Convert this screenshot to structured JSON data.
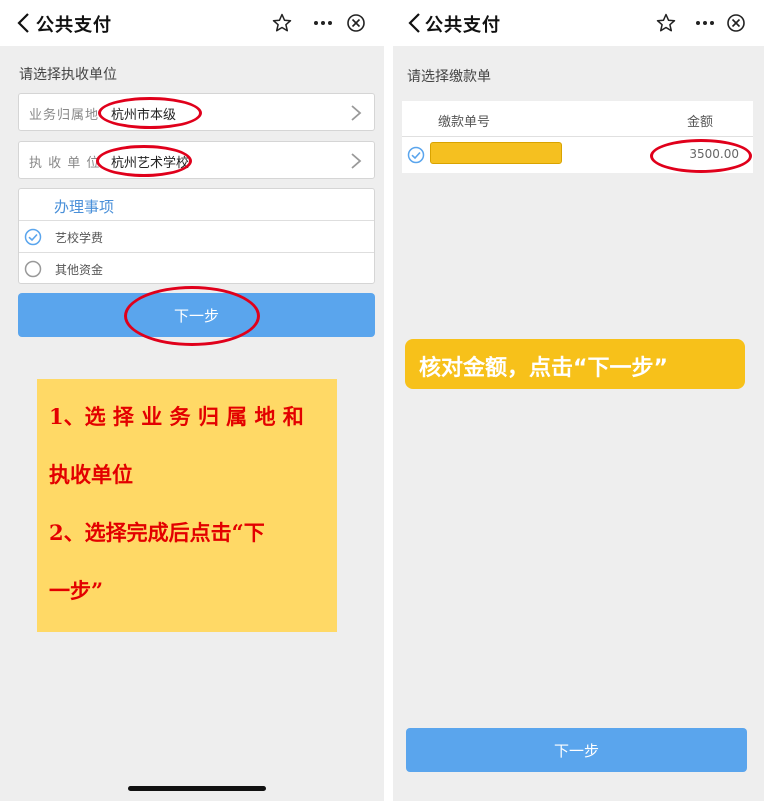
{
  "left": {
    "title": "公共支付",
    "section_label": "请选择执收单位",
    "fields": [
      {
        "label": "业务归属地",
        "value": "杭州市本级"
      },
      {
        "label": "执 收 单 位",
        "value": "杭州艺术学校"
      }
    ],
    "options_title": "办理事项",
    "options": [
      {
        "label": "艺校学费",
        "selected": true
      },
      {
        "label": "其他资金",
        "selected": false
      }
    ],
    "next_label": "下一步",
    "note_lines": [
      "1、选 择 业 务 归 属 地 和",
      "执收单位",
      "2、选择完成后点击“下",
      "一步”"
    ]
  },
  "right": {
    "title": "公共支付",
    "section_label": "请选择缴款单",
    "table_headers": [
      "缴款单号",
      "金额"
    ],
    "rows": [
      {
        "number": "",
        "amount": "3500.00",
        "selected": true
      }
    ],
    "callout": "核对金额，点击“下一步”",
    "next_label": "下一步"
  },
  "colors": {
    "accent_blue": "#5aa5ed",
    "highlight_red": "#e0001b",
    "note_yellow": "#ffd966",
    "callout_yellow": "#f7c11a"
  }
}
